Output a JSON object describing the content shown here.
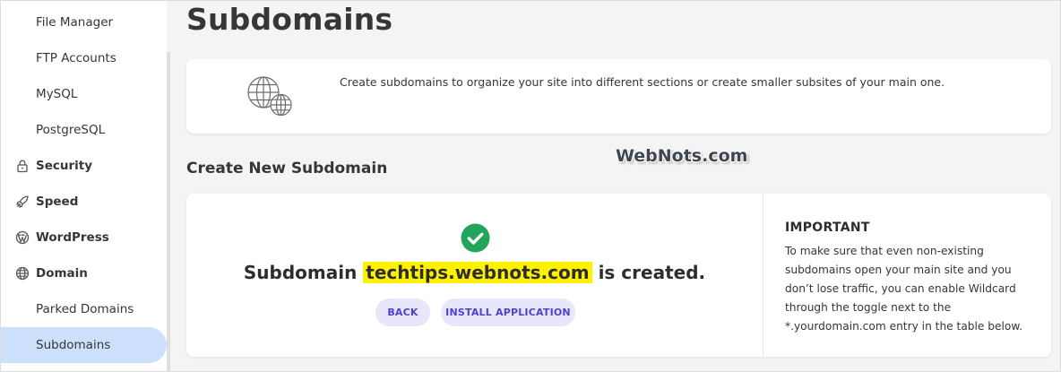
{
  "sidebar": {
    "items": [
      {
        "label": "File Manager",
        "type": "sub"
      },
      {
        "label": "FTP Accounts",
        "type": "sub"
      },
      {
        "label": "MySQL",
        "type": "sub"
      },
      {
        "label": "PostgreSQL",
        "type": "sub"
      },
      {
        "label": "Security",
        "type": "section",
        "icon": "lock-icon"
      },
      {
        "label": "Speed",
        "type": "section",
        "icon": "rocket-icon"
      },
      {
        "label": "WordPress",
        "type": "section",
        "icon": "wordpress-icon"
      },
      {
        "label": "Domain",
        "type": "section",
        "icon": "globe-icon"
      },
      {
        "label": "Parked Domains",
        "type": "sub"
      },
      {
        "label": "Subdomains",
        "type": "sub",
        "active": true
      }
    ]
  },
  "main": {
    "title": "Subdomains",
    "intro": {
      "icon": "globe-icon",
      "text": "Create subdomains to organize your site into different sections or create smaller subsites of your main one."
    },
    "watermark": "WebNots.com",
    "create_section": {
      "title": "Create New Subdomain",
      "status_icon": "check-circle-icon",
      "message_prefix": "Subdomain",
      "subdomain": "techtips.webnots.com",
      "message_suffix": "is created.",
      "back_label": "BACK",
      "install_label": "INSTALL APPLICATION"
    },
    "important": {
      "title": "IMPORTANT",
      "body": "To make sure that even non-existing subdomains open your main site and you don’t lose traffic, you can enable Wildcard through the toggle next to the *.yourdomain.com entry in the table below."
    }
  },
  "colors": {
    "accent_highlight": "#fff200",
    "success": "#22a45a",
    "button_bg": "#e8e6fb",
    "button_text": "#4c43c8",
    "active_nav": "#cde0fb"
  }
}
